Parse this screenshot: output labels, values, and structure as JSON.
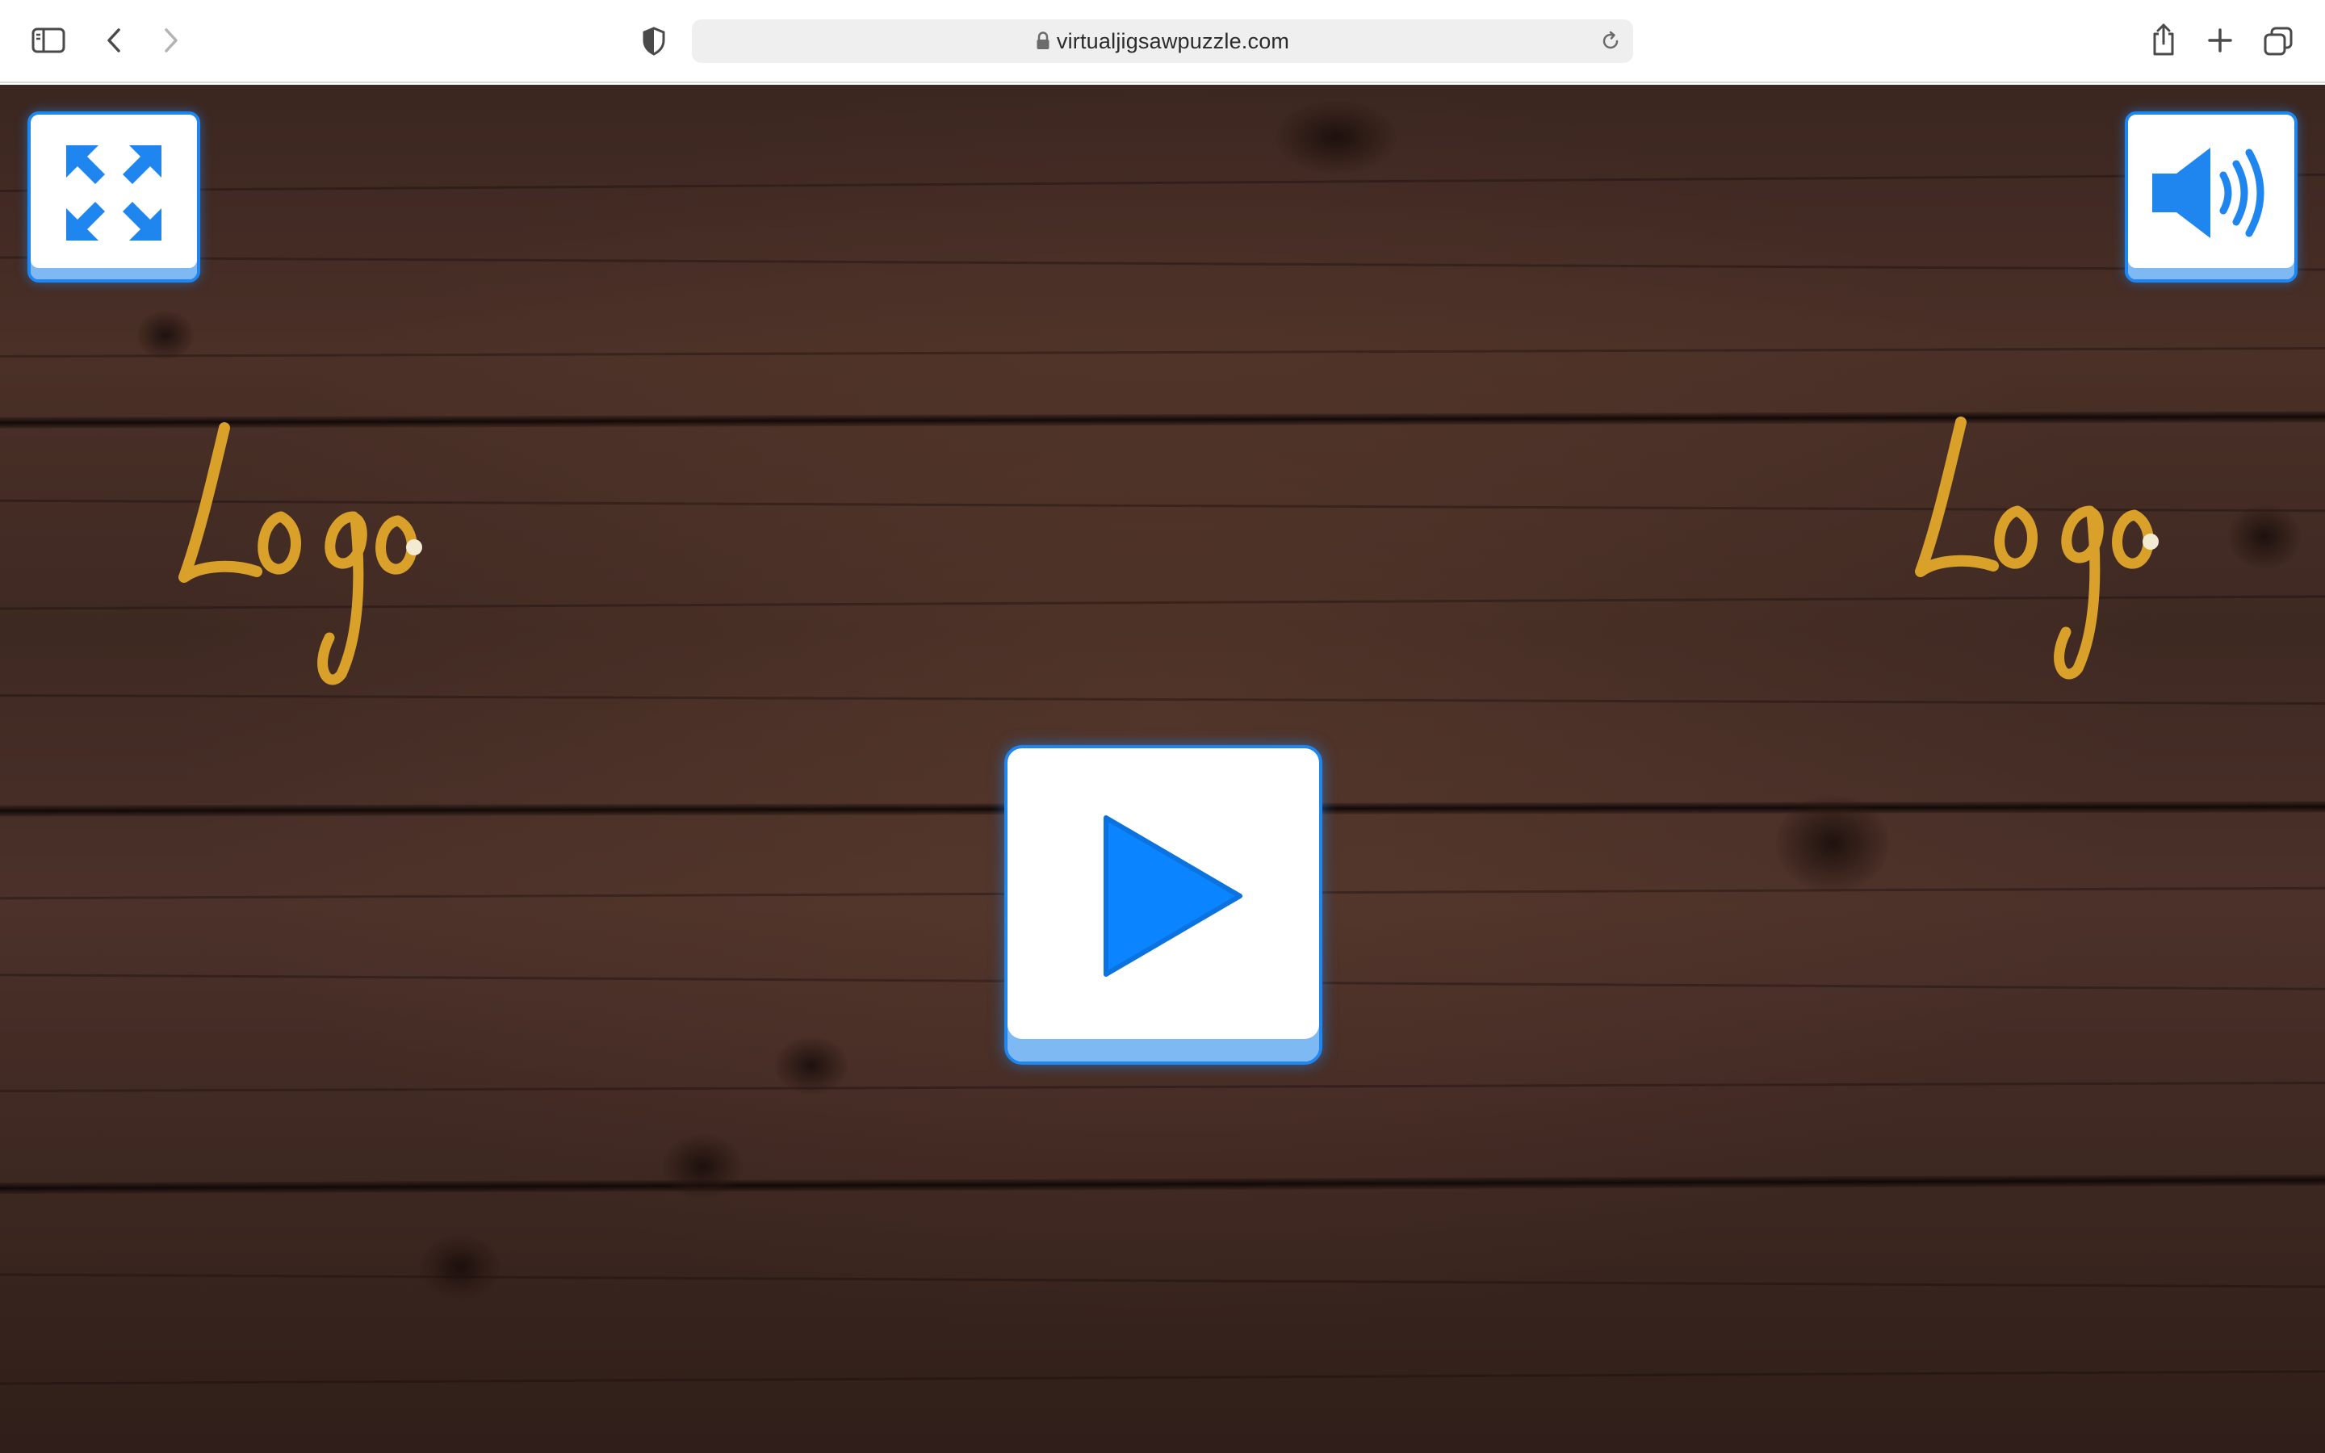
{
  "browser": {
    "url": "virtualjigsawpuzzle.com",
    "icons": {
      "sidebar": "sidebar-toggle-icon",
      "back": "chevron-left-icon",
      "forward": "chevron-right-icon",
      "privacy": "shield-icon",
      "lock": "lock-icon",
      "reload": "reload-icon",
      "share": "share-icon",
      "new_tab": "plus-icon",
      "tabs": "tabs-overview-icon"
    }
  },
  "game": {
    "logo_text": "Logo",
    "buttons": {
      "fullscreen": "expand-arrows-icon",
      "sound": "speaker-icon",
      "play": "play-icon"
    }
  },
  "colors": {
    "button_blue": "#1F86F0",
    "logo_gold": "#D9A02A",
    "wood_dark": "#3B2620"
  }
}
